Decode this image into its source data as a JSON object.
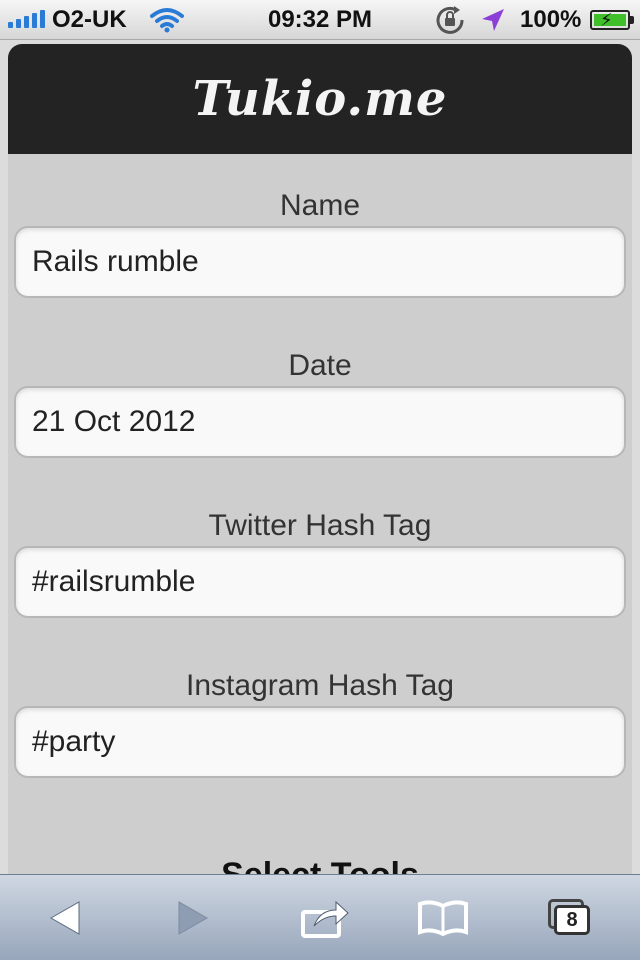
{
  "status_bar": {
    "carrier": "O2-UK",
    "time": "09:32 PM",
    "battery_percent": "100%",
    "signal_bars": 5,
    "icons": [
      "signal-icon",
      "wifi-icon",
      "rotation-lock-icon",
      "location-icon",
      "battery-icon"
    ]
  },
  "app": {
    "title": "Tukio.me"
  },
  "form": {
    "name": {
      "label": "Name",
      "value": "Rails rumble"
    },
    "date": {
      "label": "Date",
      "value": "21 Oct 2012"
    },
    "twitter": {
      "label": "Twitter Hash Tag",
      "value": "#railsrumble"
    },
    "instagram": {
      "label": "Instagram Hash Tag",
      "value": "#party"
    }
  },
  "section": {
    "heading": "Select Tools"
  },
  "toolbar": {
    "tabs_count": "8",
    "icons": [
      "back-arrow-icon",
      "forward-arrow-icon",
      "share-icon",
      "bookmarks-icon",
      "tabs-icon"
    ]
  },
  "colors": {
    "header_bg": "#232323",
    "page_bg": "#cecece",
    "toolbar_top": "#cfd7e2",
    "toolbar_bottom": "#97a6bb",
    "signal_blue": "#2a7bd6",
    "battery_green": "#3fbf2a"
  }
}
